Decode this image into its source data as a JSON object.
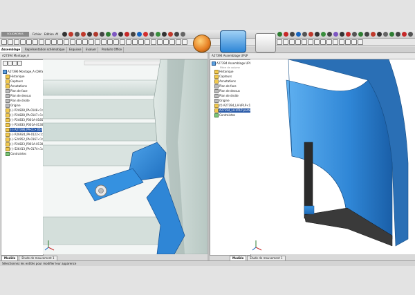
{
  "app": {
    "logo": "SOLIDWORKS",
    "menu": [
      "Fichier",
      "Edition",
      "Af"
    ],
    "tabs": [
      "Assemblage",
      "Représentation schématique",
      "Esquisse",
      "Evaluer",
      "Produits Office"
    ]
  },
  "left_pane": {
    "header": "A27394 Montage_A",
    "tree": [
      {
        "label": "A27396 Montage_A (Défau",
        "icon": "assembly-icon"
      },
      {
        "label": "Historique",
        "icon": "history-icon"
      },
      {
        "label": "Capteurs",
        "icon": "sensor-icon"
      },
      {
        "label": "Annotations",
        "icon": "annotation-icon"
      },
      {
        "label": "Plan de face",
        "icon": "plane-icon"
      },
      {
        "label": "Plan de dessus",
        "icon": "plane-icon"
      },
      {
        "label": "Plan de droite",
        "icon": "plane-icon"
      },
      {
        "label": "Origine",
        "icon": "origin-icon"
      },
      {
        "label": "(-) P24828_PA-0148<1>",
        "icon": "part-icon"
      },
      {
        "label": "(-) P24828_PA-0147<1>",
        "icon": "part-icon"
      },
      {
        "label": "(-) P24833_P001A-0185",
        "icon": "part-icon"
      },
      {
        "label": "(-) P24833_P001A-0130",
        "icon": "part-icon"
      },
      {
        "label": "(-) A27396_PA<1> (D4",
        "icon": "part-icon",
        "selected": true
      },
      {
        "label": "(-) R26924_PA-0122<1>",
        "icon": "part-icon"
      },
      {
        "label": "(-) S24952_PA-0167<1>",
        "icon": "part-icon"
      },
      {
        "label": "(-) P24823_P001A-0130",
        "icon": "part-icon"
      },
      {
        "label": "(-) S26413_PA-0174<1>",
        "icon": "part-icon"
      },
      {
        "label": "Contraintes",
        "icon": "mate-icon"
      }
    ],
    "bottom_tabs": [
      "Modèle",
      "Etude de mouvement 1"
    ]
  },
  "right_pane": {
    "header": "A27394 Assemblage UPLP",
    "overlay": "Pièce de volume",
    "tree": [
      {
        "label": "A27394 Assemblage UPLP_C",
        "icon": "assembly-icon"
      },
      {
        "label": "Historique",
        "icon": "history-icon"
      },
      {
        "label": "Capteurs",
        "icon": "sensor-icon"
      },
      {
        "label": "Annotations",
        "icon": "annotation-icon"
      },
      {
        "label": "Plan de face",
        "icon": "plane-icon"
      },
      {
        "label": "Plan de dessus",
        "icon": "plane-icon"
      },
      {
        "label": "Plan de droite",
        "icon": "plane-icon"
      },
      {
        "label": "Origine",
        "icon": "origin-icon"
      },
      {
        "label": "(f) A27394_LA-VPLP<1>",
        "icon": "part-icon"
      },
      {
        "label": "A27394_LA-VPLP parte s",
        "icon": "part-icon",
        "selected": true
      },
      {
        "label": "Contraintes",
        "icon": "mate-icon"
      }
    ],
    "bottom_tabs": [
      "Modèle",
      "Etude de mouvement 1"
    ]
  },
  "status": {
    "text": "Sélectionnez les entités pour modifier leur apparence"
  },
  "colors": {
    "part_blue": "#2f86d6",
    "selection": "#2a5aa8",
    "steel": "#c9d6d2"
  }
}
